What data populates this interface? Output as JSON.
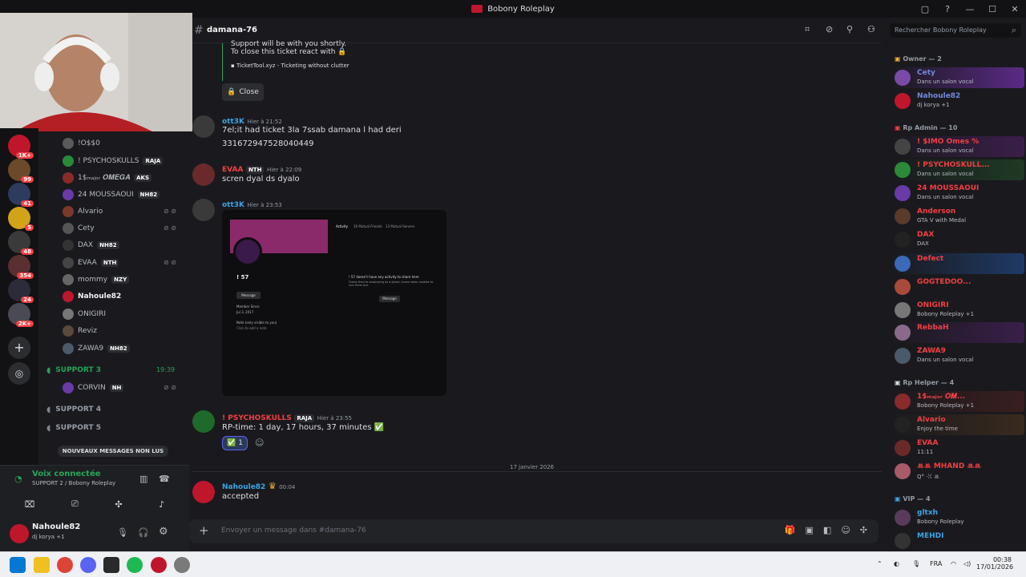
{
  "window": {
    "title": "Bobony Roleplay",
    "controls": [
      "▢",
      "?",
      "—",
      "☐",
      "✕"
    ]
  },
  "guild_badges": [
    "1K+",
    "99",
    "41",
    "5",
    "48",
    "354",
    "24",
    "2K+"
  ],
  "channel_list": {
    "users_top": [
      {
        "name": "!O$$0",
        "tag": "",
        "color": "#b5bac1"
      },
      {
        "name": "! PSYCHOSKULLS",
        "tag": "RAJA",
        "color": "#b5bac1"
      },
      {
        "name": "1$ₘₐⱼₒᵣ 𝑶𝑴𝑬𝑮𝑨",
        "tag": "AKS",
        "color": "#b5bac1"
      },
      {
        "name": "24 MOUSSAOUI",
        "tag": "NH82",
        "color": "#b5bac1"
      },
      {
        "name": "Alvario",
        "tag": "",
        "color": "#b5bac1"
      },
      {
        "name": "Cety",
        "tag": "",
        "color": "#b5bac1"
      },
      {
        "name": "DAX",
        "tag": "NH82",
        "color": "#b5bac1"
      },
      {
        "name": "EVAA",
        "tag": "NTH",
        "color": "#b5bac1"
      },
      {
        "name": "mommy",
        "tag": "NZY",
        "color": "#b5bac1"
      },
      {
        "name": "Nahoule82",
        "tag": "",
        "color": "#f2f3f5"
      },
      {
        "name": "ONIGIRI",
        "tag": "",
        "color": "#b5bac1"
      },
      {
        "name": "Reviz",
        "tag": "",
        "color": "#b5bac1"
      },
      {
        "name": "ZAWA9",
        "tag": "NH82",
        "color": "#b5bac1"
      }
    ],
    "support3": {
      "name": "SUPPORT 3",
      "time": "19:39"
    },
    "support3_user": {
      "name": "CORVIN",
      "tag": "NH"
    },
    "support4": "SUPPORT 4",
    "support5": "SUPPORT 5",
    "unread_pill": "NOUVEAUX MESSAGES NON LUS"
  },
  "voice_panel": {
    "status": "Voix connectée",
    "channel": "SUPPORT 2 / Bobony Roleplay"
  },
  "user_panel": {
    "name": "Nahoule82",
    "status": "dj korya +1"
  },
  "header": {
    "channel": "damana-76",
    "search_placeholder": "Rechercher Bobony Roleplay"
  },
  "messages": {
    "embed_line1": "Support will be with you shortly.",
    "embed_line2": "To close this ticket react with",
    "embed_footer": "TicketTool.xyz - Ticketing without clutter",
    "close_label": "Close",
    "m1": {
      "author": "ott3K",
      "time": "Hier à 21:52",
      "line1": "7el;it had ticket 3la 7ssab damana l had deri",
      "line2": "331672947528040449"
    },
    "m2": {
      "author": "EVAA",
      "tag": "NTH",
      "time": "Hier à 22:09",
      "text": "scren dyal ds dyalo"
    },
    "m3": {
      "author": "ott3K",
      "time": "Hier à 23:53"
    },
    "m3_image": {
      "tabs": [
        "Activity",
        "16 Mutual Friends",
        "13 Mutual Servers"
      ],
      "username": "! 57",
      "empty_title": "! 57 doesn't have any activity to share here",
      "empty_sub": "Guess they're cosplaying as a ghost. Leave some cookies to lure them out.",
      "btn": "Message",
      "member_since": "Member Since",
      "date": "Jul 3, 2017",
      "note_label": "Note (only visible to you)",
      "note_ph": "Click to add a note"
    },
    "m4": {
      "author": "! PSYCHOSKULLS",
      "tag": "RAJA",
      "time": "Hier à 23:55",
      "text": "RP-time:  1 day, 17 hours, 37 minutes ✅",
      "reaction_count": "1"
    },
    "date_divider": "17 janvier 2026",
    "m5": {
      "author": "Nahoule82",
      "time": "00:04",
      "text": "accepted"
    }
  },
  "composer": {
    "placeholder": "Envoyer un message dans #damana-76"
  },
  "members": {
    "owner_cat": "Owner — 2",
    "owners": [
      {
        "name": "Cety",
        "status": "Dans un salon vocal",
        "color": "#7289da",
        "bg": "#5b2a86"
      },
      {
        "name": "Nahoule82",
        "status": "dj korya +1",
        "color": "#7289da",
        "bg": ""
      }
    ],
    "admin_cat": "Rp Admin — 10",
    "admins": [
      {
        "name": "! $IMO Omes %",
        "tag": "NH82",
        "status": "Dans un salon vocal",
        "color": "#f23f43",
        "bg": "#3b1e4a"
      },
      {
        "name": "! PSYCHOSKULL...",
        "tag": "RAJA",
        "status": "Dans un salon vocal",
        "color": "#f23f43",
        "bg": "#1e3a24"
      },
      {
        "name": "24 MOUSSAOUI",
        "tag": "NH82",
        "status": "Dans un salon vocal",
        "color": "#f23f43",
        "bg": ""
      },
      {
        "name": "Anderson",
        "tag": "",
        "status": "GTA V with Medal",
        "color": "#f23f43",
        "bg": ""
      },
      {
        "name": "DAX",
        "tag": "NH82",
        "status": "DAX",
        "color": "#f23f43",
        "bg": ""
      },
      {
        "name": "Defect",
        "tag": "NH82",
        "status": "",
        "color": "#f23f43",
        "bg": "#1f3a66"
      },
      {
        "name": "GOGTEDOO...",
        "tag": "NH82",
        "status": "",
        "color": "#f23f43",
        "bg": ""
      },
      {
        "name": "ONIGIRI",
        "tag": "",
        "status": "Bobony Roleplay +1",
        "color": "#f23f43",
        "bg": ""
      },
      {
        "name": "RebbaH",
        "tag": "",
        "status": "",
        "color": "#f23f43",
        "bg": "#3a1e4a"
      },
      {
        "name": "ZAWA9",
        "tag": "NH82",
        "status": "Dans un salon vocal",
        "color": "#f23f43",
        "bg": ""
      }
    ],
    "helper_cat": "Rp Helper — 4",
    "helpers": [
      {
        "name": "1$ₘₐⱼₒᵣ 𝑶𝑴...",
        "tag": "AKS",
        "status": "Bobony Roleplay +1",
        "color": "#f23f43",
        "bg": "#3a1e1e"
      },
      {
        "name": "Alvario",
        "tag": "",
        "status": "Enjoy the time",
        "color": "#f23f43",
        "bg": "#3a2a1e"
      },
      {
        "name": "EVAA",
        "tag": "NTH",
        "status": "11:11",
        "color": "#f23f43",
        "bg": ""
      },
      {
        "name": "ꔛꔛ MHAND ꔛꔛ",
        "tag": "AKS",
        "status": "Q° ·ꈍ ꔛ",
        "color": "#f23f43",
        "bg": ""
      }
    ],
    "vip_cat": "VIP — 4",
    "vips": [
      {
        "name": "gltxh",
        "tag": "",
        "status": "Bobony Roleplay",
        "color": "#3ba5e6",
        "bg": ""
      },
      {
        "name": "MEHDI",
        "tag": "VF1",
        "status": "",
        "color": "#3ba5e6",
        "bg": ""
      }
    ]
  },
  "taskbar": {
    "lang": "FRA",
    "time": "00:38",
    "date": "17/01/2026"
  }
}
